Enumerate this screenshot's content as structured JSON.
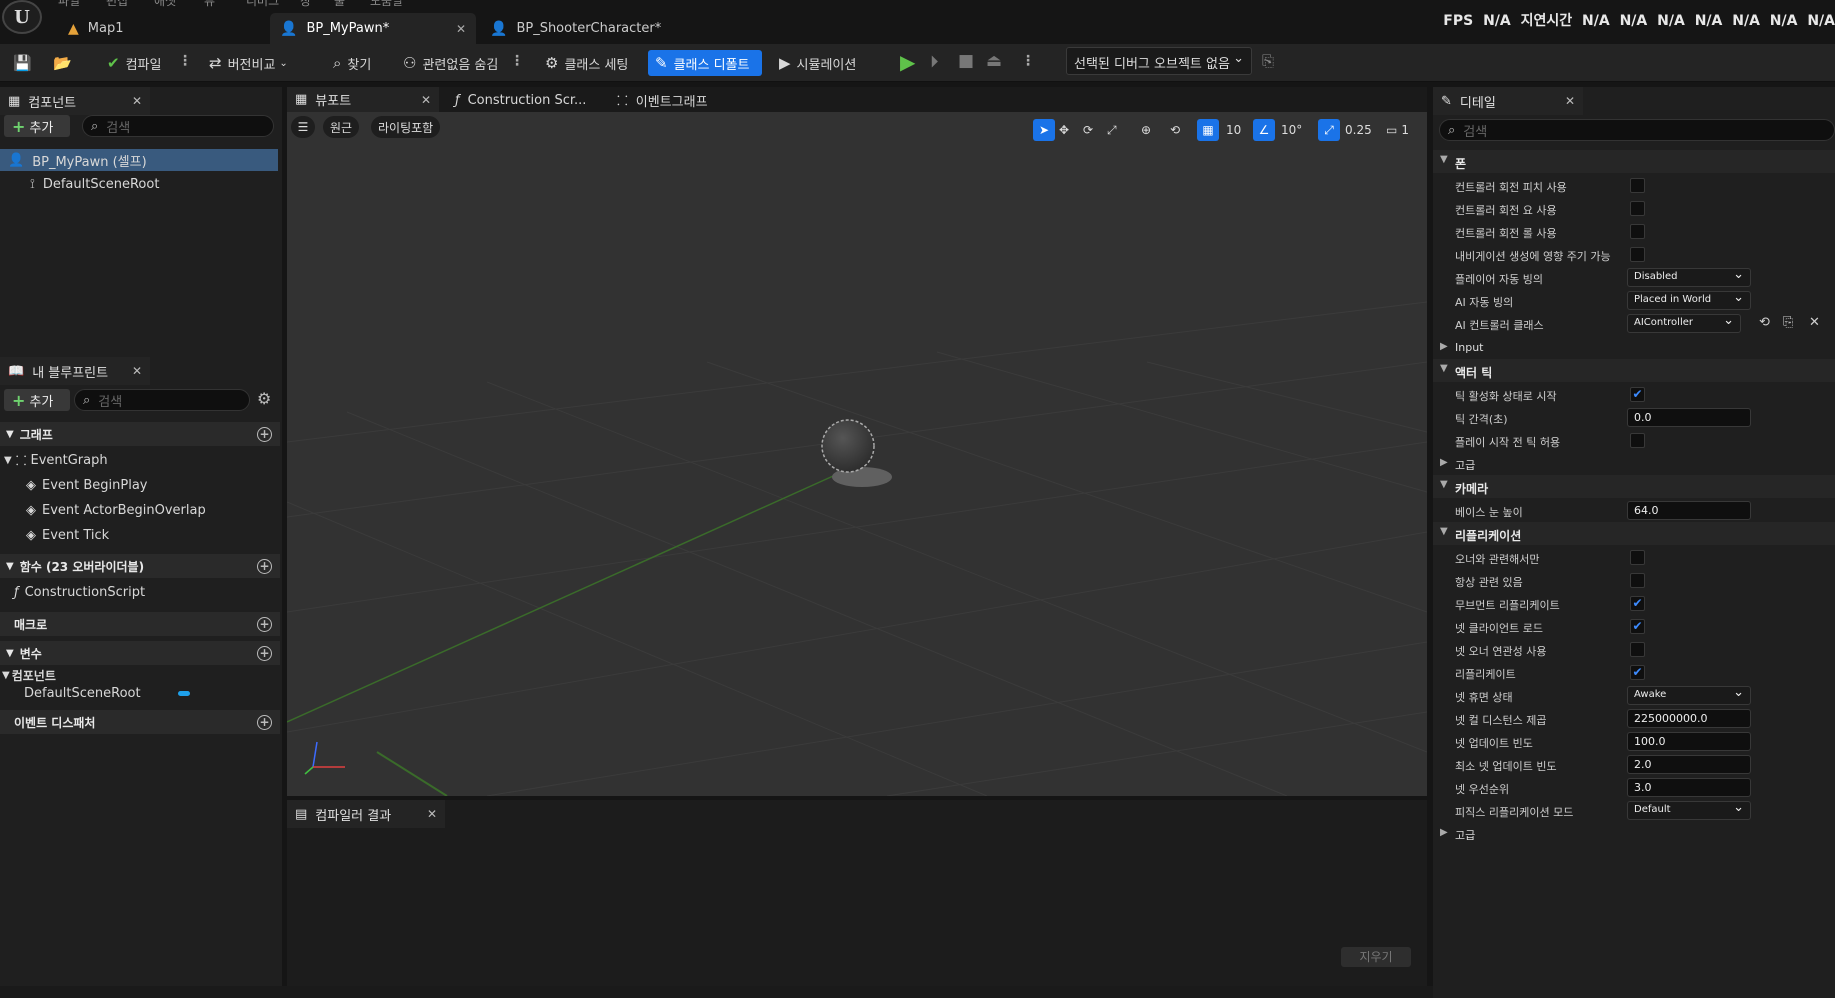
{
  "app": {
    "logo": "U",
    "menu": [
      "파일",
      "편집",
      "애셋",
      "뷰",
      "디버그",
      "창",
      "툴",
      "도움말"
    ],
    "tabs": [
      {
        "label": "Map1",
        "icon": "map-icon"
      },
      {
        "label": "BP_MyPawn*",
        "icon": "blueprint-icon"
      },
      {
        "label": "BP_ShooterCharacter*",
        "icon": "blueprint-icon"
      }
    ],
    "stats": {
      "fps_label": "FPS",
      "fps_value": "N/A",
      "latency_label": "지연시간",
      "values": [
        "N/A",
        "N/A",
        "N/A",
        "N/A",
        "N/A",
        "N/A",
        "N/A",
        "N/A"
      ]
    }
  },
  "toolbar": {
    "compile": "컴파일",
    "diff": "버전비교",
    "find": "찾기",
    "hide_unrelated": "관련없음 숨김",
    "class_settings": "클래스 세팅",
    "class_defaults": "클래스 디폴트",
    "simulation": "시뮬레이션",
    "debug_object": "선택된 디버그 오브젝트 없음"
  },
  "components": {
    "title": "컴포넌트",
    "add": "추가",
    "search_placeholder": "검색",
    "items": [
      "BP_MyPawn (셀프)",
      "DefaultSceneRoot"
    ]
  },
  "my_blueprint": {
    "title": "내 블루프린트",
    "add": "추가",
    "search_placeholder": "검색",
    "graphs": "그래프",
    "event_graph": "EventGraph",
    "events": [
      "Event BeginPlay",
      "Event ActorBeginOverlap",
      "Event Tick"
    ],
    "functions": "함수 (23 오버라이더블)",
    "construction": "ConstructionScript",
    "macros": "매크로",
    "variables": "변수",
    "components": "컴포넌트",
    "default_scene_root": "DefaultSceneRoot",
    "event_dispatchers": "이벤트 디스패처"
  },
  "editor_tabs": {
    "viewport": "뷰포트",
    "construction": "Construction Scr...",
    "event_graph": "이벤트그래프"
  },
  "viewport": {
    "perspective": "원근",
    "lit": "라이팅포함",
    "grid_snap": "10",
    "rotation_snap": "10°",
    "scale_snap": "0.25",
    "camera_speed": "1"
  },
  "compiler": {
    "title": "컴파일러 결과",
    "clear": "지우기"
  },
  "details": {
    "title": "디테일",
    "search_placeholder": "검색",
    "sections": {
      "pawn": "폰",
      "input": "Input",
      "actor_tick": "액터 틱",
      "advanced1": "고급",
      "camera": "카메라",
      "replication": "리플리케이션",
      "advanced2": "고급"
    },
    "rows": {
      "use_pitch": "컨트롤러 회전 피치 사용",
      "use_yaw": "컨트롤러 회전 요 사용",
      "use_roll": "컨트롤러 회전 롤 사용",
      "nav_affects": "내비게이션 생성에 영향 주기 가능",
      "auto_possess_player": "플레이어 자동 빙의",
      "auto_possess_player_value": "Disabled",
      "auto_possess_ai": "AI 자동 빙의",
      "auto_possess_ai_value": "Placed in World",
      "ai_controller": "AI 컨트롤러 클래스",
      "ai_controller_value": "AIController",
      "start_tick_enabled": "틱 활성화 상태로 시작",
      "tick_interval": "틱 간격(초)",
      "tick_interval_value": "0.0",
      "tick_before_play": "플레이 시작 전 틱 허용",
      "base_eye_height": "베이스 눈 높이",
      "base_eye_height_value": "64.0",
      "only_relevant_owner": "오너와 관련해서만",
      "always_relevant": "항상 관련 있음",
      "replicate_movement": "무브먼트 리플리케이트",
      "net_load_client": "넷 클라이언트 로드",
      "net_use_owner_relevancy": "넷 오너 연관성 사용",
      "replicates": "리플리케이트",
      "net_dormancy": "넷 휴면 상태",
      "net_dormancy_value": "Awake",
      "net_cull_distance": "넷 컬 디스턴스 제곱",
      "net_cull_distance_value": "225000000.0",
      "net_update_freq": "넷 업데이트 빈도",
      "net_update_freq_value": "100.0",
      "min_net_update_freq": "최소 넷 업데이트 빈도",
      "min_net_update_freq_value": "2.0",
      "net_priority": "넷 우선순위",
      "net_priority_value": "3.0",
      "physics_rep_mode": "피직스 리플리케이션 모드",
      "physics_rep_mode_value": "Default"
    },
    "checks": {
      "use_pitch": false,
      "use_yaw": false,
      "use_roll": false,
      "nav_affects": false,
      "start_tick_enabled": true,
      "tick_before_play": false,
      "only_relevant_owner": false,
      "always_relevant": false,
      "replicate_movement": true,
      "net_load_client": true,
      "net_use_owner_relevancy": false,
      "replicates": true
    }
  },
  "colors": {
    "accent": "#1a73e8",
    "check": "#3d8bff",
    "play": "#5fc24a"
  }
}
